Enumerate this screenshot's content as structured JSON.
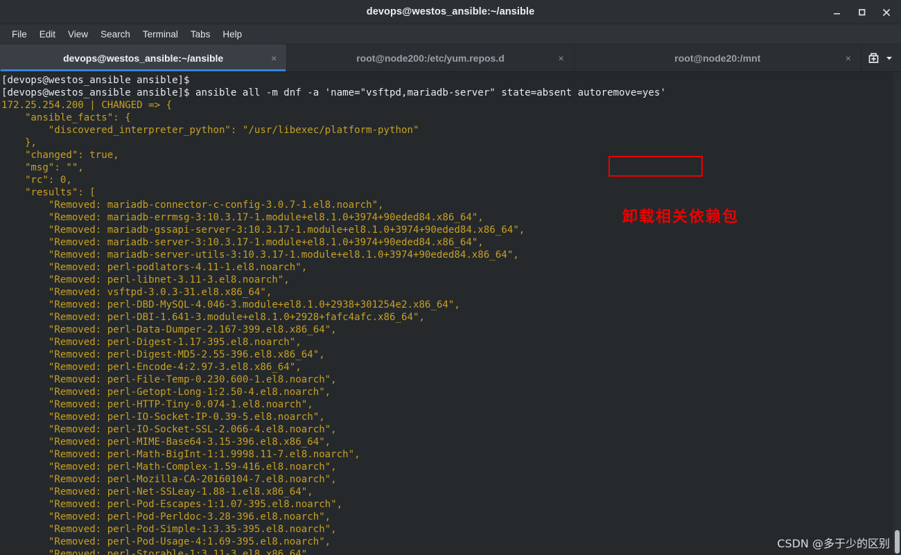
{
  "window": {
    "title": "devops@westos_ansible:~/ansible",
    "controls": {
      "minimize": "minimize",
      "maximize": "maximize",
      "close": "close"
    }
  },
  "menubar": {
    "items": [
      "File",
      "Edit",
      "View",
      "Search",
      "Terminal",
      "Tabs",
      "Help"
    ]
  },
  "tabs": [
    {
      "label": "devops@westos_ansible:~/ansible",
      "active": true,
      "close": "×"
    },
    {
      "label": "root@node200:/etc/yum.repos.d",
      "active": false,
      "close": "×"
    },
    {
      "label": "root@node20:/mnt",
      "active": false,
      "close": "×"
    }
  ],
  "tabbar_actions": {
    "new_tab": "new-tab-icon",
    "tab_menu": "chevron-down-icon"
  },
  "terminal": {
    "lines": [
      {
        "kind": "prompt",
        "text": "[devops@westos_ansible ansible]$"
      },
      {
        "kind": "prompt",
        "text": "[devops@westos_ansible ansible]$ ansible all -m dnf -a 'name=\"vsftpd,mariadb-server\" state=absent autoremove=yes'"
      },
      {
        "kind": "out",
        "text": "172.25.254.200 | CHANGED => {"
      },
      {
        "kind": "out",
        "text": "    \"ansible_facts\": {"
      },
      {
        "kind": "out",
        "text": "        \"discovered_interpreter_python\": \"/usr/libexec/platform-python\""
      },
      {
        "kind": "out",
        "text": "    },"
      },
      {
        "kind": "out",
        "text": "    \"changed\": true,"
      },
      {
        "kind": "out",
        "text": "    \"msg\": \"\","
      },
      {
        "kind": "out",
        "text": "    \"rc\": 0,"
      },
      {
        "kind": "out",
        "text": "    \"results\": ["
      },
      {
        "kind": "out",
        "text": "        \"Removed: mariadb-connector-c-config-3.0.7-1.el8.noarch\","
      },
      {
        "kind": "out",
        "text": "        \"Removed: mariadb-errmsg-3:10.3.17-1.module+el8.1.0+3974+90eded84.x86_64\","
      },
      {
        "kind": "out",
        "text": "        \"Removed: mariadb-gssapi-server-3:10.3.17-1.module+el8.1.0+3974+90eded84.x86_64\","
      },
      {
        "kind": "out",
        "text": "        \"Removed: mariadb-server-3:10.3.17-1.module+el8.1.0+3974+90eded84.x86_64\","
      },
      {
        "kind": "out",
        "text": "        \"Removed: mariadb-server-utils-3:10.3.17-1.module+el8.1.0+3974+90eded84.x86_64\","
      },
      {
        "kind": "out",
        "text": "        \"Removed: perl-podlators-4.11-1.el8.noarch\","
      },
      {
        "kind": "out",
        "text": "        \"Removed: perl-libnet-3.11-3.el8.noarch\","
      },
      {
        "kind": "out",
        "text": "        \"Removed: vsftpd-3.0.3-31.el8.x86_64\","
      },
      {
        "kind": "out",
        "text": "        \"Removed: perl-DBD-MySQL-4.046-3.module+el8.1.0+2938+301254e2.x86_64\","
      },
      {
        "kind": "out",
        "text": "        \"Removed: perl-DBI-1.641-3.module+el8.1.0+2928+fafc4afc.x86_64\","
      },
      {
        "kind": "out",
        "text": "        \"Removed: perl-Data-Dumper-2.167-399.el8.x86_64\","
      },
      {
        "kind": "out",
        "text": "        \"Removed: perl-Digest-1.17-395.el8.noarch\","
      },
      {
        "kind": "out",
        "text": "        \"Removed: perl-Digest-MD5-2.55-396.el8.x86_64\","
      },
      {
        "kind": "out",
        "text": "        \"Removed: perl-Encode-4:2.97-3.el8.x86_64\","
      },
      {
        "kind": "out",
        "text": "        \"Removed: perl-File-Temp-0.230.600-1.el8.noarch\","
      },
      {
        "kind": "out",
        "text": "        \"Removed: perl-Getopt-Long-1:2.50-4.el8.noarch\","
      },
      {
        "kind": "out",
        "text": "        \"Removed: perl-HTTP-Tiny-0.074-1.el8.noarch\","
      },
      {
        "kind": "out",
        "text": "        \"Removed: perl-IO-Socket-IP-0.39-5.el8.noarch\","
      },
      {
        "kind": "out",
        "text": "        \"Removed: perl-IO-Socket-SSL-2.066-4.el8.noarch\","
      },
      {
        "kind": "out",
        "text": "        \"Removed: perl-MIME-Base64-3.15-396.el8.x86_64\","
      },
      {
        "kind": "out",
        "text": "        \"Removed: perl-Math-BigInt-1:1.9998.11-7.el8.noarch\","
      },
      {
        "kind": "out",
        "text": "        \"Removed: perl-Math-Complex-1.59-416.el8.noarch\","
      },
      {
        "kind": "out",
        "text": "        \"Removed: perl-Mozilla-CA-20160104-7.el8.noarch\","
      },
      {
        "kind": "out",
        "text": "        \"Removed: perl-Net-SSLeay-1.88-1.el8.x86_64\","
      },
      {
        "kind": "out",
        "text": "        \"Removed: perl-Pod-Escapes-1:1.07-395.el8.noarch\","
      },
      {
        "kind": "out",
        "text": "        \"Removed: perl-Pod-Perldoc-3.28-396.el8.noarch\","
      },
      {
        "kind": "out",
        "text": "        \"Removed: perl-Pod-Simple-1:3.35-395.el8.noarch\","
      },
      {
        "kind": "out",
        "text": "        \"Removed: perl-Pod-Usage-4:1.69-395.el8.noarch\","
      },
      {
        "kind": "out",
        "text": "        \"Removed: perl-Storable-1:3.11-3.el8.x86_64\","
      }
    ]
  },
  "annotation": {
    "highlight_text": "autoremove=yes",
    "note": "卸载相关依赖包",
    "highlight_color": "#ee0000"
  },
  "watermark": {
    "text": "CSDN @多于少的区别"
  }
}
